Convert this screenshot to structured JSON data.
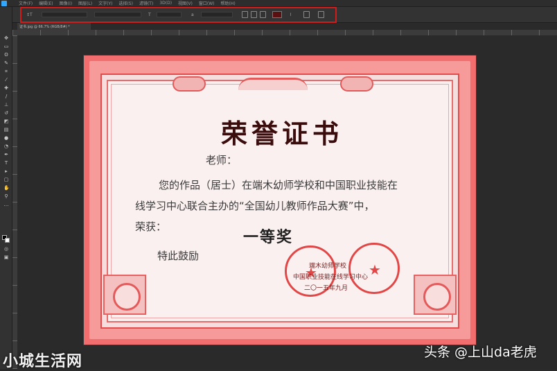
{
  "menu": {
    "items": [
      "文件(F)",
      "编辑(E)",
      "图像(I)",
      "图层(L)",
      "文字(Y)",
      "选择(S)",
      "滤镜(T)",
      "3D(D)",
      "视图(V)",
      "窗口(W)",
      "帮助(H)"
    ]
  },
  "options_bar": {
    "highlight_color": "#d21c1c",
    "swatch_color": "#5a1010"
  },
  "document_tab": {
    "label": "证书.jpg @ 66.7% (RGB/8#) *"
  },
  "certificate": {
    "title": "荣誉证书",
    "salutation": "老师：",
    "line1": "您的作品（居士）在端木幼师学校和中国职业技能在",
    "line2": "线学习中心联合主办的“全国幼儿教师作品大赛”中，",
    "line3": "荣获：",
    "award": "一等奖",
    "closing": "特此鼓励",
    "issuer1": "端木幼师学校",
    "issuer2": "中国职业技能在线学习中心",
    "date": "二〇一五年九月"
  },
  "watermarks": {
    "left": "小城生活网",
    "right": "头条 @上山da老虎"
  }
}
